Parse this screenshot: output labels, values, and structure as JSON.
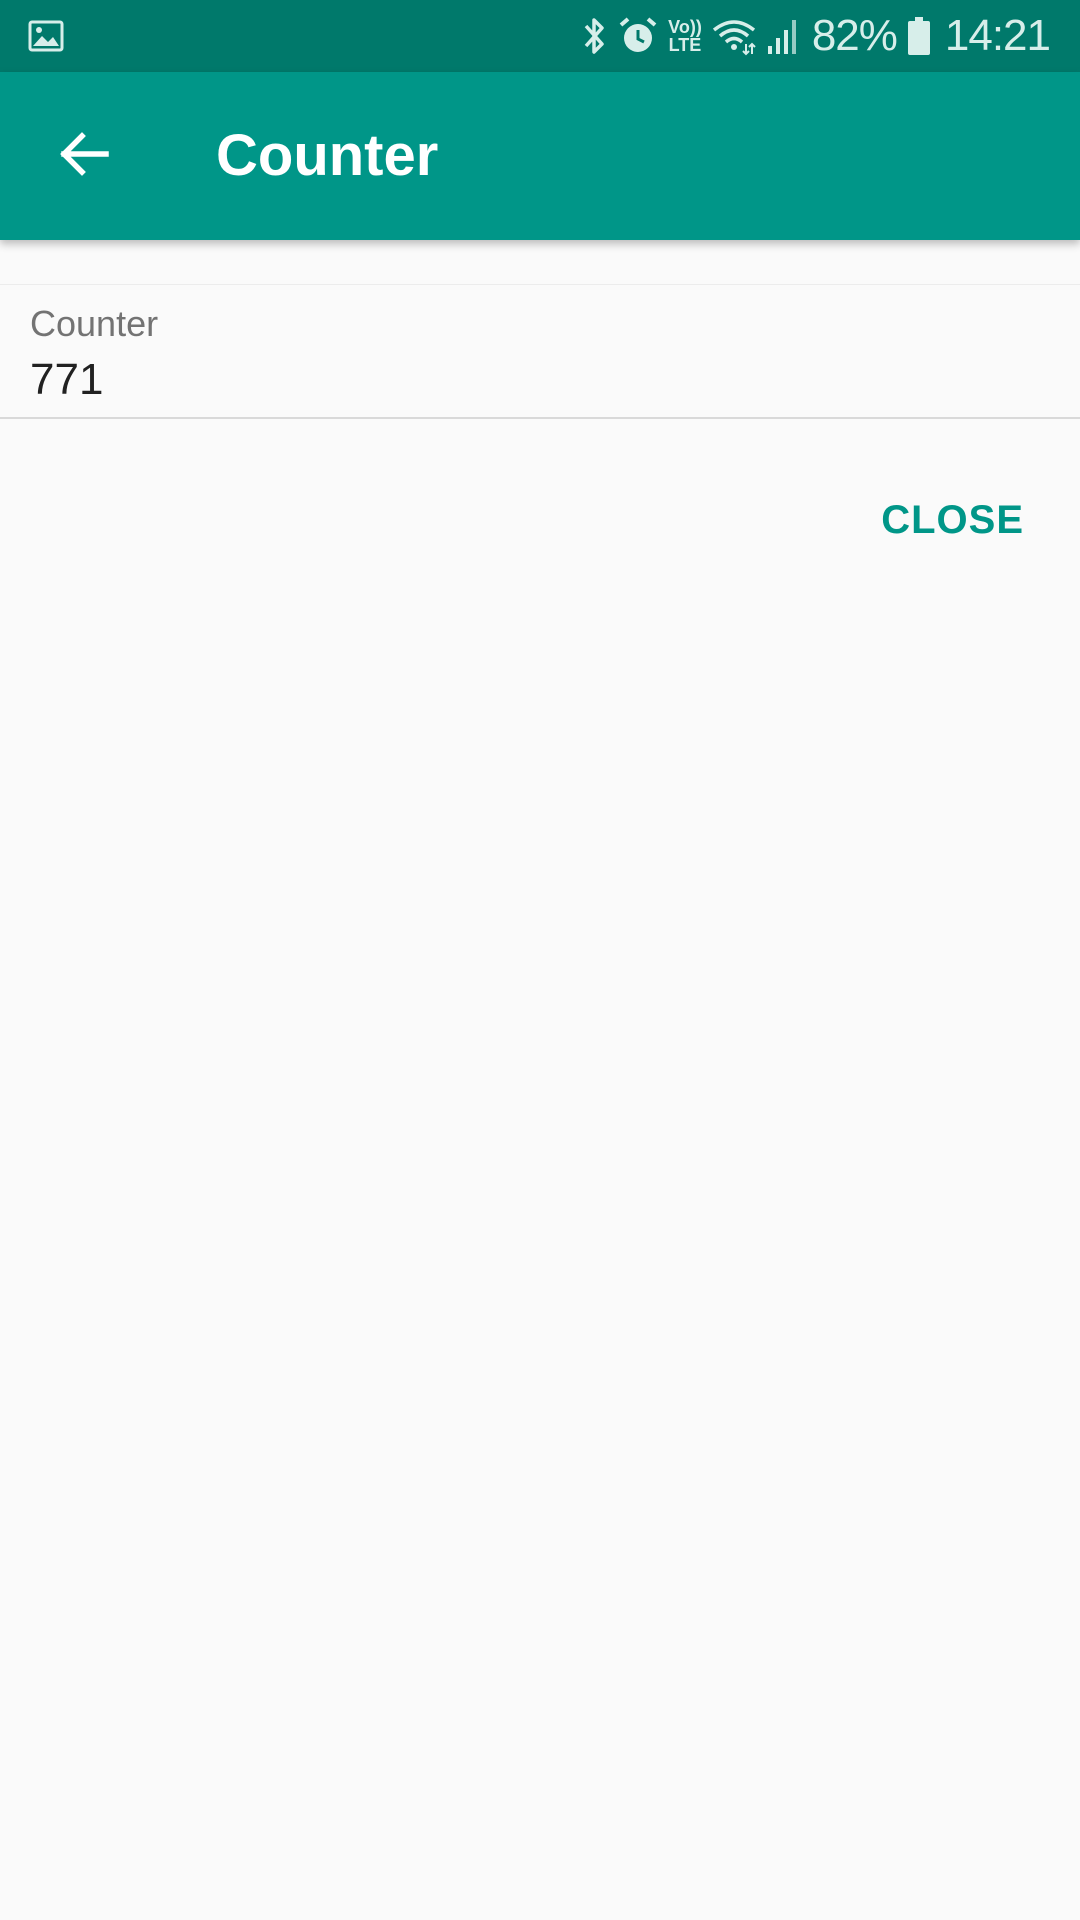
{
  "status_bar": {
    "battery_percent": "82%",
    "time": "14:21",
    "icons": [
      "gallery-icon",
      "bluetooth-icon",
      "alarm-icon",
      "volte-icon",
      "wifi-icon",
      "signal-icon",
      "battery-icon"
    ],
    "volte_top": "Vo))",
    "volte_bottom": "LTE"
  },
  "app_bar": {
    "title": "Counter",
    "back_icon": "arrow-back-icon"
  },
  "field": {
    "label": "Counter",
    "value": "771"
  },
  "actions": {
    "close_label": "CLOSE"
  },
  "colors": {
    "status_bar": "#00796b",
    "app_bar": "#009688",
    "accent": "#009688",
    "background": "#fafafa"
  }
}
